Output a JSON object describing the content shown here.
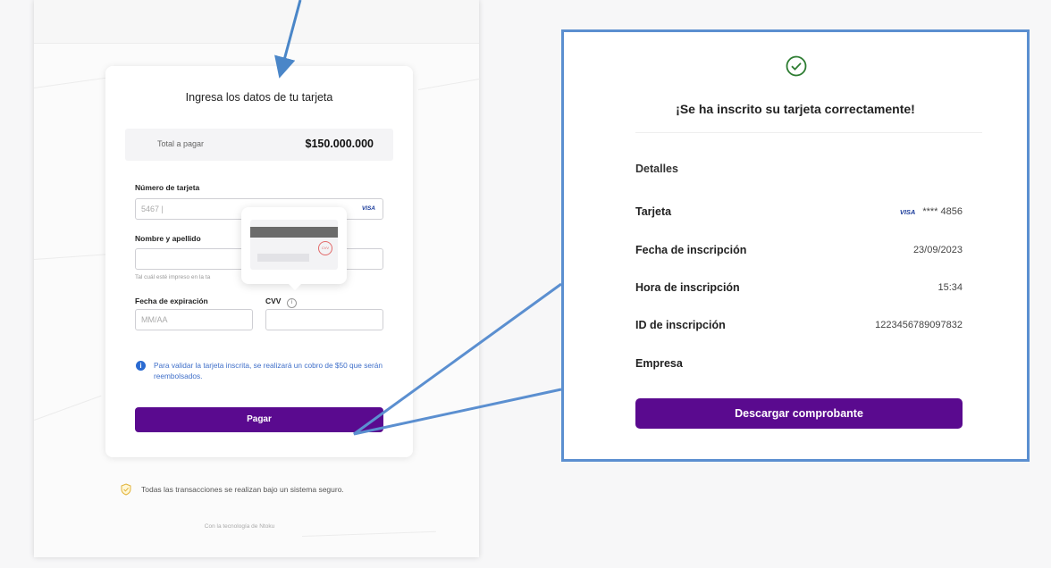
{
  "payment_form": {
    "title": "Ingresa los datos de tu tarjeta",
    "total_label": "Total a pagar",
    "total_value": "$150.000.000",
    "card_number_label": "Número de tarjeta",
    "card_number_value": "5467 |",
    "card_brand": "VISA",
    "name_label": "Nombre y apellido",
    "name_hint": "Tal cuál esté impreso en la ta",
    "expiry_label": "Fecha de expiración",
    "expiry_placeholder": "MM/AA",
    "cvv_label": "CVV",
    "cvv_tooltip_mark": "CVV",
    "info_text": "Para validar la tarjeta inscrita, se realizará un cobro de $50 que serán reembolsados.",
    "pay_button": "Pagar",
    "secure_text": "Todas las transacciones se realizan bajo un sistema seguro.",
    "tech_text": "Con la tecnología de  Ntoku"
  },
  "success_panel": {
    "title": "¡Se ha inscrito su tarjeta correctamente!",
    "details_heading": "Detalles",
    "rows": [
      {
        "label": "Tarjeta",
        "brand": "VISA",
        "value": "**** 4856"
      },
      {
        "label": "Fecha de inscripción",
        "value": "23/09/2023"
      },
      {
        "label": "Hora de inscripción",
        "value": "15:34"
      },
      {
        "label": "ID de inscripción",
        "value": "1223456789097832"
      },
      {
        "label": "Empresa",
        "value": ""
      }
    ],
    "download_button": "Descargar comprobante"
  },
  "colors": {
    "primary": "#5a0a8f",
    "info": "#3f6fc9",
    "accent_border": "#5b8fd0",
    "success_icon": "#2e7d32"
  }
}
